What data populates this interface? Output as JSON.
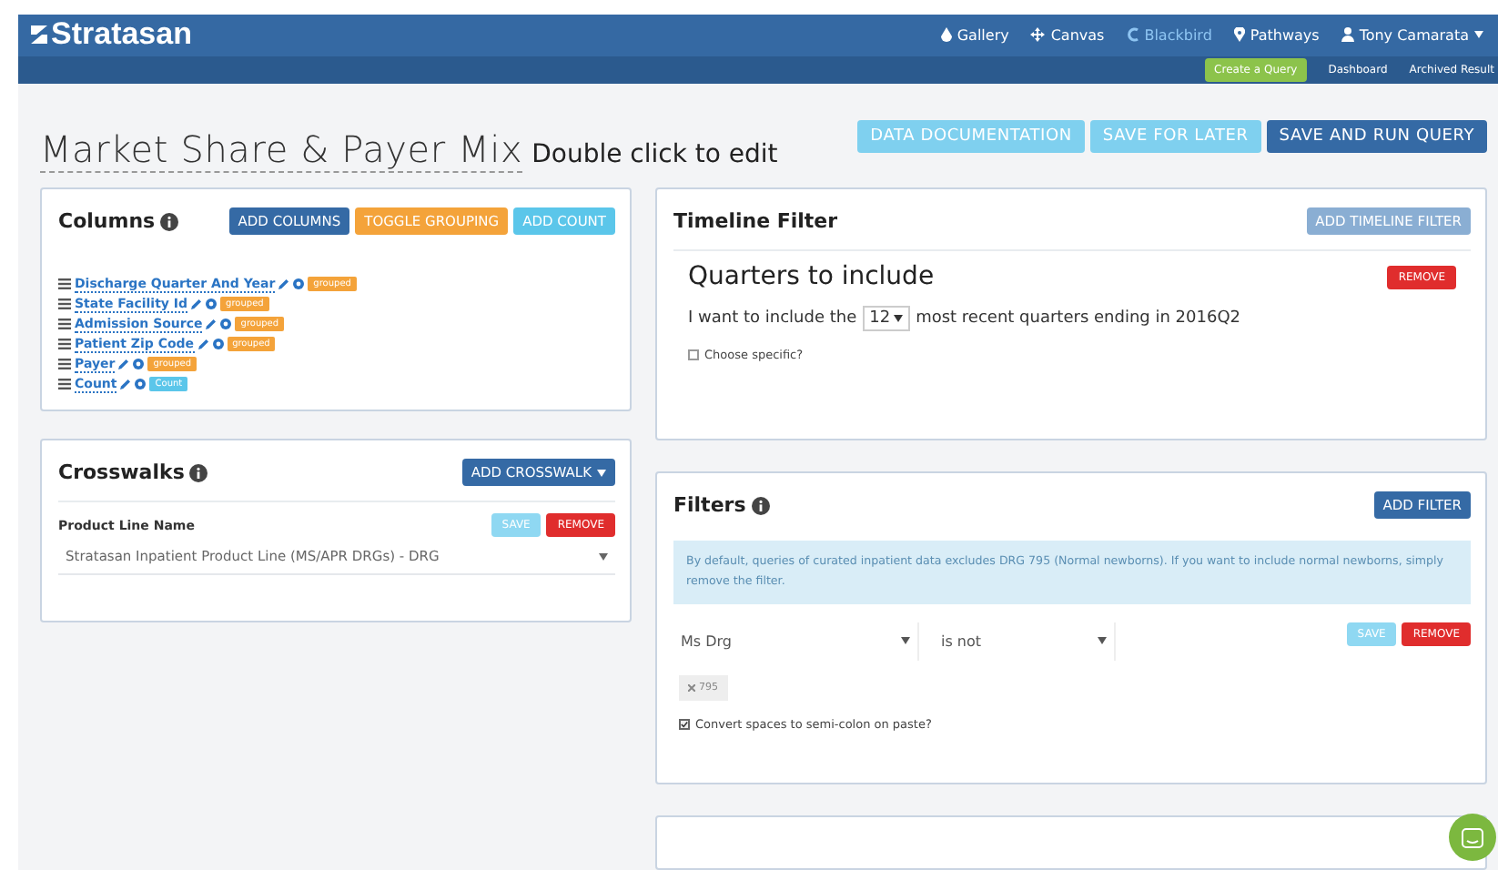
{
  "brand": "Stratasan",
  "nav": [
    {
      "label": "Gallery",
      "selected": false
    },
    {
      "label": "Canvas",
      "selected": false
    },
    {
      "label": "Blackbird",
      "selected": true
    },
    {
      "label": "Pathways",
      "selected": false
    },
    {
      "label": "Tony Camarata",
      "selected": false
    }
  ],
  "subnav": {
    "primary": "Create a Query",
    "links": [
      "Dashboard",
      "Archived Result"
    ]
  },
  "title": "Market Share & Payer Mix",
  "title_hint": "Double click to edit",
  "actions": [
    {
      "label": "DATA DOCUMENTATION",
      "kind": "light"
    },
    {
      "label": "SAVE FOR LATER",
      "kind": "light"
    },
    {
      "label": "SAVE AND RUN QUERY",
      "kind": "dark"
    }
  ],
  "columns_card": {
    "title": "Columns",
    "buttons": [
      {
        "label": "ADD COLUMNS",
        "kind": "dark"
      },
      {
        "label": "TOGGLE GROUPING",
        "kind": "orange"
      },
      {
        "label": "ADD COUNT",
        "kind": "cyan"
      }
    ],
    "items": [
      {
        "label": "Discharge Quarter And Year",
        "tag": "grouped",
        "kind": "grouped"
      },
      {
        "label": "State Facility Id",
        "tag": "grouped",
        "kind": "grouped"
      },
      {
        "label": "Admission Source",
        "tag": "grouped",
        "kind": "grouped"
      },
      {
        "label": "Patient Zip Code",
        "tag": "grouped",
        "kind": "grouped"
      },
      {
        "label": "Payer",
        "tag": "grouped",
        "kind": "grouped"
      },
      {
        "label": "Count",
        "tag": "Count",
        "kind": "count"
      }
    ]
  },
  "crosswalks_card": {
    "title": "Crosswalks",
    "button": "ADD CROSSWALK",
    "field_label": "Product Line Name",
    "save": "SAVE",
    "remove": "REMOVE",
    "select_value": "Stratasan Inpatient Product Line (MS/APR DRGs) - DRG"
  },
  "timeline_card": {
    "title": "Timeline Filter",
    "button": "ADD TIMELINE FILTER",
    "heading": "Quarters to include",
    "remove": "REMOVE",
    "sentence_before": "I want to include the",
    "count": "12",
    "sentence_after": "most recent quarters ending in 2016Q2",
    "checkbox": {
      "label": "Choose specific?",
      "checked": false
    }
  },
  "filters_card": {
    "title": "Filters",
    "button": "ADD FILTER",
    "notice": "By default, queries of curated inpatient data excludes DRG 795 (Normal newborns). If you want to include normal newborns, simply remove the filter.",
    "field": "Ms Drg",
    "operator": "is not",
    "save": "SAVE",
    "remove": "REMOVE",
    "token": "795",
    "checkbox": {
      "label": "Convert spaces to semi-colon on paste?",
      "checked": true
    }
  }
}
